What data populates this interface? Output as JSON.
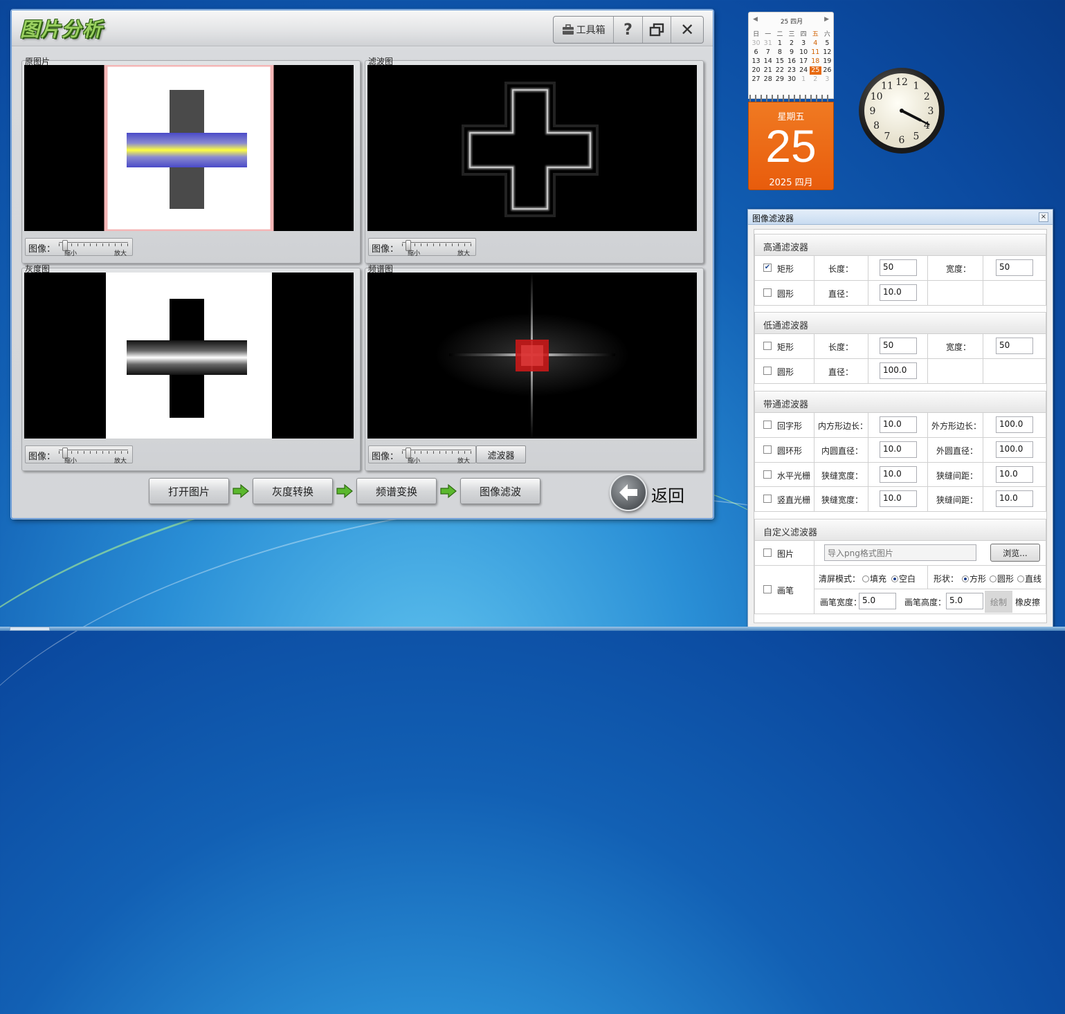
{
  "main_window": {
    "title": "图片分析",
    "toolbar": {
      "toolbox_label": "工具箱",
      "help_label": "?",
      "close_label": "✕"
    },
    "panels": {
      "original": {
        "label": "原图片"
      },
      "filtered": {
        "label": "滤波图"
      },
      "grayscale": {
        "label": "灰度图"
      },
      "spectrum": {
        "label": "频谱图"
      }
    },
    "zoom": {
      "label": "图像：",
      "min_label": "缩小",
      "max_label": "放大",
      "level": 0.05
    },
    "filter_button": "滤波器",
    "steps": [
      "打开图片",
      "灰度转换",
      "频谱变换",
      "图像滤波"
    ],
    "back_label": "返回"
  },
  "calendar": {
    "month_header": "25 四月",
    "weekdays": [
      "日",
      "一",
      "二",
      "三",
      "四",
      "五",
      "六"
    ],
    "weeks": [
      [
        "30",
        "31",
        "1",
        "2",
        "3",
        "4",
        "5"
      ],
      [
        "6",
        "7",
        "8",
        "9",
        "10",
        "11",
        "12"
      ],
      [
        "13",
        "14",
        "15",
        "16",
        "17",
        "18",
        "19"
      ],
      [
        "20",
        "21",
        "22",
        "23",
        "24",
        "25",
        "26"
      ],
      [
        "27",
        "28",
        "29",
        "30",
        "1",
        "2",
        "3"
      ]
    ],
    "selected_day": "25",
    "weekday_name": "星期五",
    "day": "25",
    "year_month": "2025 四月"
  },
  "clock": {
    "numbers": [
      "12",
      "1",
      "2",
      "3",
      "4",
      "5",
      "6",
      "7",
      "8",
      "9",
      "10",
      "11"
    ],
    "hour": 3.9,
    "minute": 19.5
  },
  "filter_dialog": {
    "title": "图像滤波器",
    "close_label": "×",
    "highpass": {
      "title": "高通滤波器",
      "rect": {
        "label": "矩形",
        "checked": true,
        "length_label": "长度：",
        "length": "50",
        "width_label": "宽度：",
        "width": "50"
      },
      "circle": {
        "label": "圆形",
        "checked": false,
        "diameter_label": "直径：",
        "diameter": "10.0"
      }
    },
    "lowpass": {
      "title": "低通滤波器",
      "rect": {
        "label": "矩形",
        "checked": false,
        "length_label": "长度：",
        "length": "50",
        "width_label": "宽度：",
        "width": "50"
      },
      "circle": {
        "label": "圆形",
        "checked": false,
        "diameter_label": "直径：",
        "diameter": "100.0"
      }
    },
    "bandpass": {
      "title": "带通滤波器",
      "square_ring": {
        "label": "回字形",
        "inner_label": "内方形边长：",
        "inner": "10.0",
        "outer_label": "外方形边长：",
        "outer": "100.0"
      },
      "annulus": {
        "label": "圆环形",
        "inner_label": "内圆直径：",
        "inner": "10.0",
        "outer_label": "外圆直径：",
        "outer": "100.0"
      },
      "hgrating": {
        "label": "水平光栅",
        "slit_width_label": "狭缝宽度：",
        "slit_width": "10.0",
        "slit_gap_label": "狭缝间距：",
        "slit_gap": "10.0"
      },
      "vgrating": {
        "label": "竖直光栅",
        "slit_width_label": "狭缝宽度：",
        "slit_width": "10.0",
        "slit_gap_label": "狭缝间距：",
        "slit_gap": "10.0"
      }
    },
    "custom": {
      "title": "自定义滤波器",
      "image": {
        "label": "图片",
        "placeholder": "导入png格式图片",
        "browse": "浏览..."
      },
      "brush": {
        "label": "画笔",
        "clear_mode_label": "清屏模式：",
        "fill_label": "填充",
        "blank_label": "空白",
        "shape_label": "形状：",
        "square_label": "方形",
        "circle_label": "圆形",
        "line_label": "直线",
        "width_label": "画笔宽度：",
        "width": "5.0",
        "height_label": "画笔高度：",
        "height": "5.0",
        "draw_label": "绘制",
        "eraser_label": "橡皮擦"
      }
    }
  }
}
